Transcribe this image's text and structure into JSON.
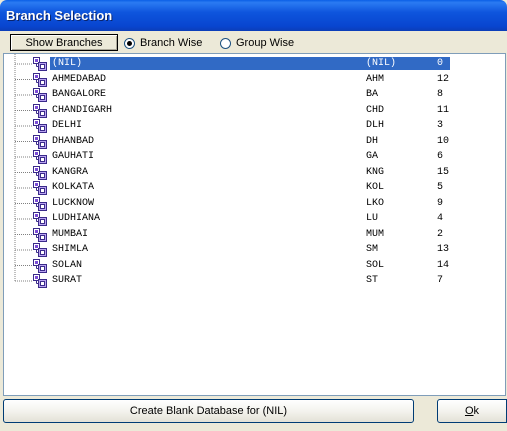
{
  "window": {
    "title": "Branch Selection"
  },
  "toolbar": {
    "show_branches_label": "Show Branches",
    "radio_branch_wise": "Branch Wise",
    "radio_group_wise": "Group Wise",
    "selected_mode": "Branch Wise"
  },
  "tree": {
    "rows": [
      {
        "name": "(NIL)",
        "code": "(NIL)",
        "id": "0",
        "selected": true
      },
      {
        "name": "AHMEDABAD",
        "code": "AHM",
        "id": "12"
      },
      {
        "name": "BANGALORE",
        "code": "BA",
        "id": "8"
      },
      {
        "name": "CHANDIGARH",
        "code": "CHD",
        "id": "11"
      },
      {
        "name": "DELHI",
        "code": "DLH",
        "id": "3"
      },
      {
        "name": "DHANBAD",
        "code": "DH",
        "id": "10"
      },
      {
        "name": "GAUHATI",
        "code": "GA",
        "id": "6"
      },
      {
        "name": "KANGRA",
        "code": "KNG",
        "id": "15"
      },
      {
        "name": "KOLKATA",
        "code": "KOL",
        "id": "5"
      },
      {
        "name": "LUCKNOW",
        "code": "LKO",
        "id": "9"
      },
      {
        "name": "LUDHIANA",
        "code": "LU",
        "id": "4"
      },
      {
        "name": "MUMBAI",
        "code": "MUM",
        "id": "2"
      },
      {
        "name": "SHIMLA",
        "code": "SM",
        "id": "13"
      },
      {
        "name": "SOLAN",
        "code": "SOL",
        "id": "14"
      },
      {
        "name": "SURAT",
        "code": "ST",
        "id": "7"
      }
    ],
    "node_icon": "database-node-icon"
  },
  "footer": {
    "create_label": "Create Blank Database for (NIL)",
    "ok_label_accel": "O",
    "ok_label_rest": "k"
  },
  "colors": {
    "title_bar": "#0a50d8",
    "selection": "#316ac5",
    "dialog_bg": "#ece9d8"
  }
}
